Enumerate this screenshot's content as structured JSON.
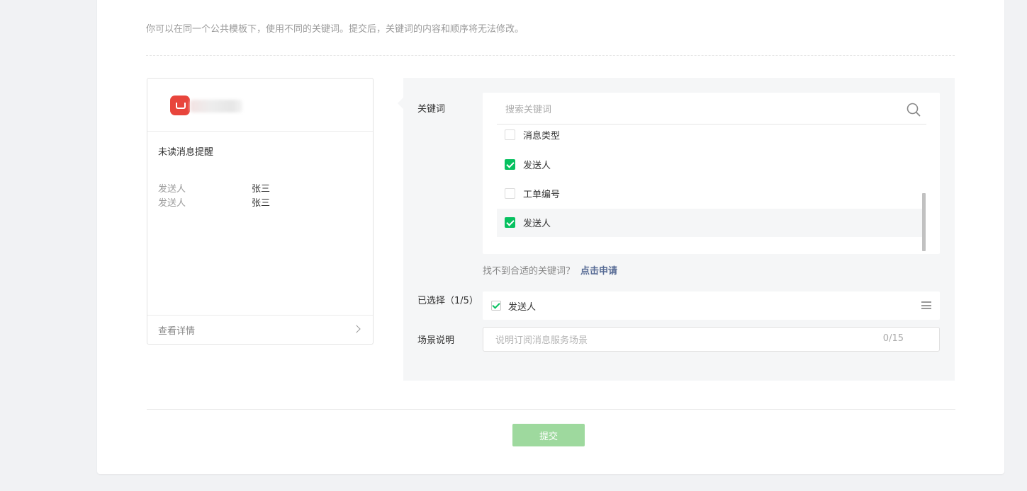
{
  "intro_text": "你可以在同一个公共模板下，使用不同的关键词。提交后，关键词的内容和顺序将无法修改。",
  "preview": {
    "title": "未读消息提醒",
    "fields": [
      {
        "key": "发送人",
        "value": "张三"
      },
      {
        "key": "发送人",
        "value": "张三"
      }
    ],
    "footer_label": "查看详情"
  },
  "keywords": {
    "label": "关键词",
    "search_placeholder": "搜索关键词",
    "items": [
      {
        "label": "消息类型",
        "checked": false
      },
      {
        "label": "发送人",
        "checked": true
      },
      {
        "label": "工单编号",
        "checked": false
      },
      {
        "label": "发送人",
        "checked": true
      }
    ],
    "hint": "找不到合适的关键词？",
    "hint_link": "点击申请"
  },
  "selected": {
    "label": "已选择（1/5）",
    "items": [
      {
        "label": "发送人"
      }
    ]
  },
  "scene": {
    "label": "场景说明",
    "placeholder": "说明订阅消息服务场景",
    "count": "0/15"
  },
  "submit_label": "提交",
  "colors": {
    "accent": "#07c160",
    "submit_disabled": "#9ed99e",
    "link": "#576b95",
    "app_logo": "#e8453c"
  }
}
